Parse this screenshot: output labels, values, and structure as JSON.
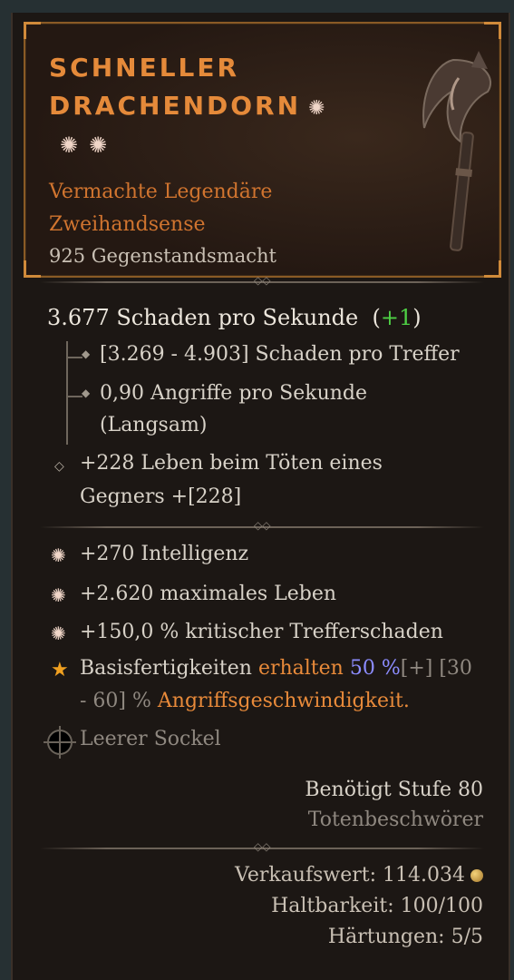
{
  "item": {
    "name_line1": "SCHNELLER",
    "name_line2": "DRACHENDORN",
    "type_line1": "Vermachte Legendäre",
    "type_line2": "Zweihandsense",
    "item_power": "925 Gegenstandsmacht"
  },
  "weapon_stats": {
    "dps_text": "3.677 Schaden pro Sekunde",
    "dps_change_prefix": "(",
    "dps_change": "+1",
    "dps_change_suffix": ")",
    "damage_range": "[3.269 - 4.903] Schaden pro Treffer",
    "attack_speed_line1": "0,90 Angriffe pro Sekunde",
    "attack_speed_line2": "(Langsam)",
    "implicit_line1": "+228 Leben beim Töten eines",
    "implicit_line2": "Gegners +[228]"
  },
  "affixes": [
    {
      "text": "+270 Intelligenz"
    },
    {
      "text": "+2.620 maximales Leben"
    },
    {
      "text": "+150,0 % kritischer Trefferschaden"
    }
  ],
  "legendary_aspect": {
    "part1": "Basisfertigkeiten ",
    "part2_orange": "erhalten",
    "part3_blue": " 50 %",
    "part4": "[+] [30",
    "line2_part1": "- 60] % ",
    "line2_part2_orange": "Angriffsgeschwindigkeit."
  },
  "socket": {
    "label": "Leerer Sockel"
  },
  "requirements": {
    "level": "Benötigt Stufe 80",
    "class": "Totenbeschwörer"
  },
  "footer": {
    "sell_value": "Verkaufswert: 114.034",
    "durability": "Haltbarkeit: 100/100",
    "tempers": "Härtungen: 5/5"
  },
  "icons": {
    "greater_affix": "flower-icon",
    "legendary": "star-icon",
    "gold": "coin-icon"
  },
  "colors": {
    "legendary_orange": "#e58a3a",
    "bonus_green": "#4ed045",
    "value_blue": "#8c8cff",
    "text": "#d8d2c8"
  }
}
